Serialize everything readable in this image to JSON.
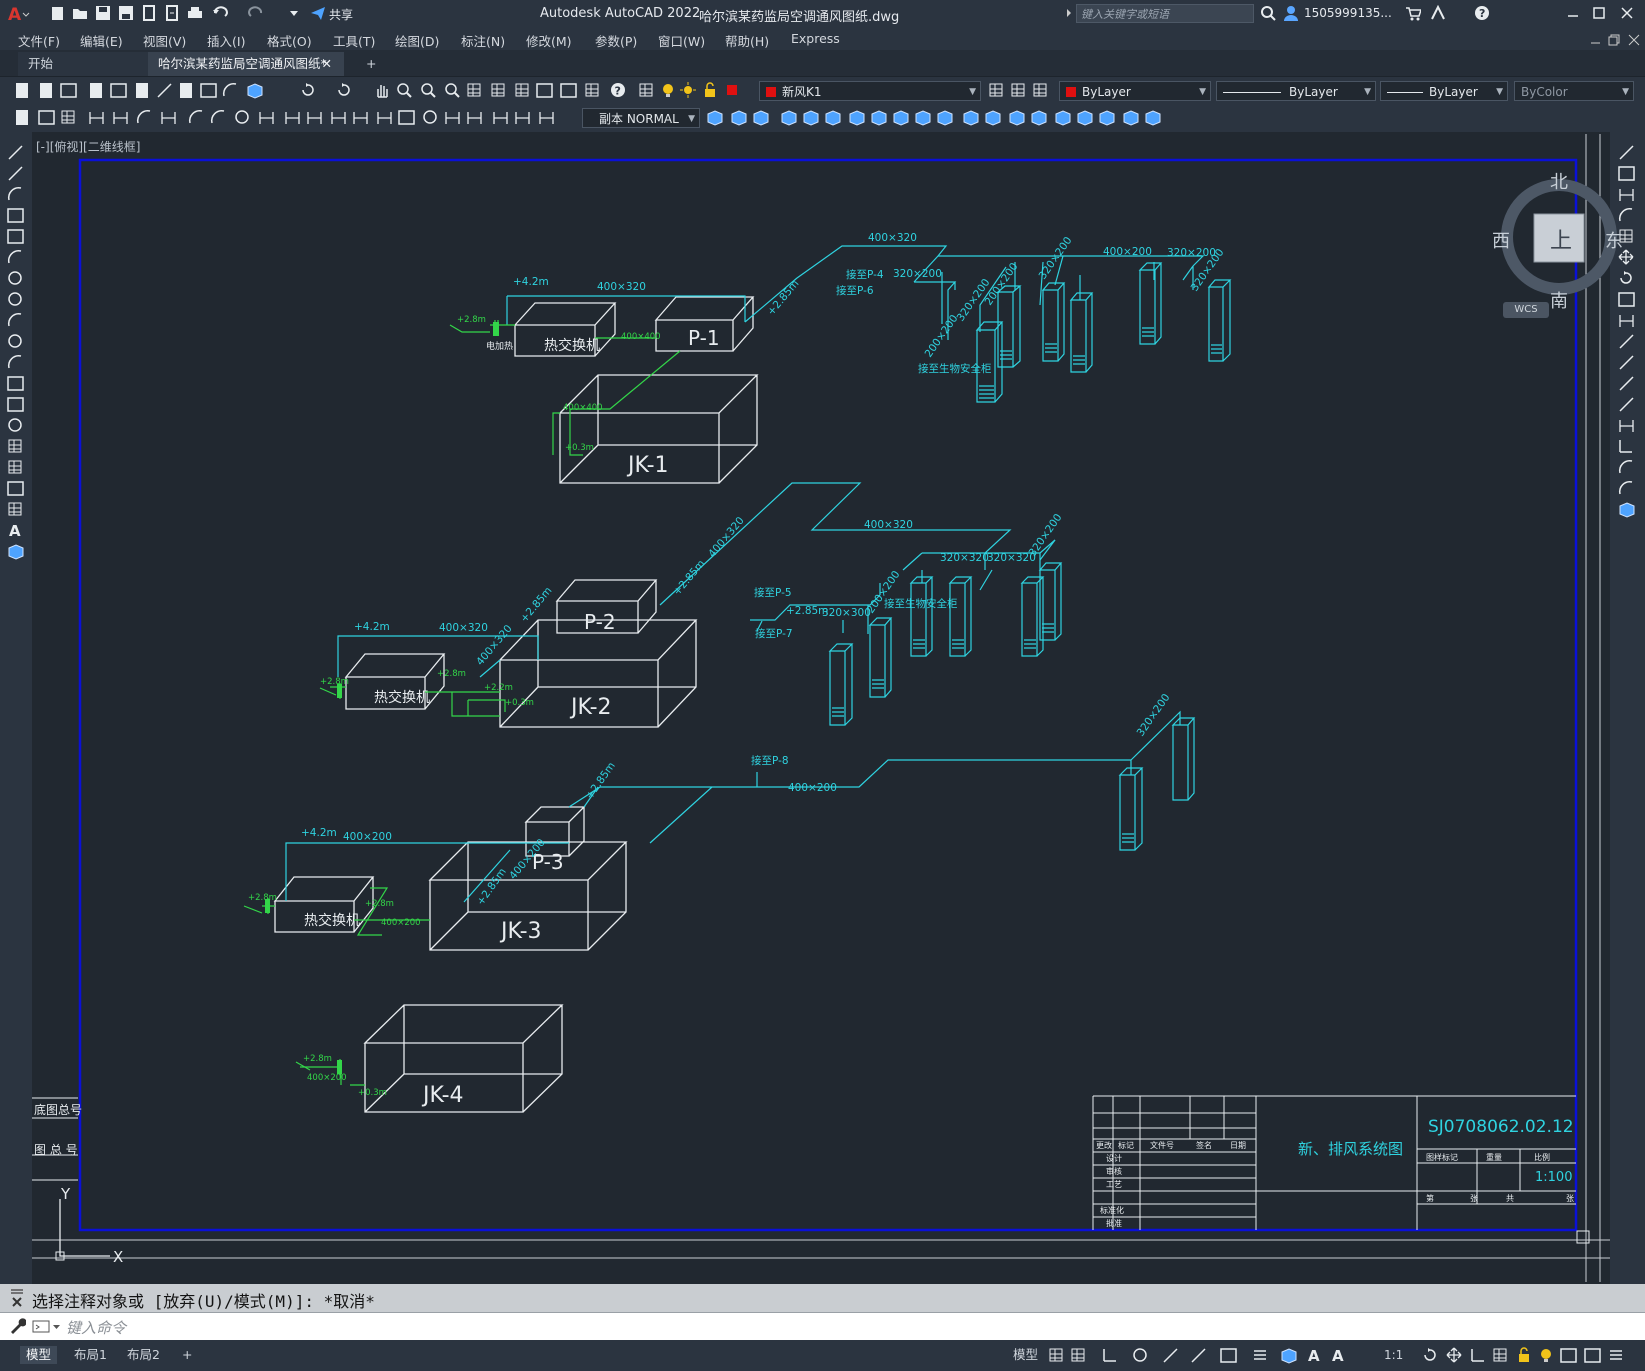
{
  "app": {
    "title": "Autodesk AutoCAD 2022",
    "filename": "哈尔滨某药监局空调通风图纸.dwg",
    "search_placeholder": "键入关键字或短语",
    "user": "1505999135...",
    "share_label": "共享"
  },
  "menu": [
    "文件(F)",
    "编辑(E)",
    "视图(V)",
    "插入(I)",
    "格式(O)",
    "工具(T)",
    "绘图(D)",
    "标注(N)",
    "修改(M)",
    "参数(P)",
    "窗口(W)",
    "帮助(H)",
    "Express"
  ],
  "tabs": {
    "start": "开始",
    "document": "哈尔滨某药监局空调通风图纸*",
    "add": "+"
  },
  "toolbar": {
    "layer": "新风K1",
    "color": "ByLayer",
    "linetype": "ByLayer",
    "lineweight": "ByLayer",
    "plotstyle": "ByColor",
    "dimstyle": "副本 NORMAL"
  },
  "viewport": {
    "label": "[-][俯视][二维线框]"
  },
  "viewcube": {
    "north": "北",
    "south": "南",
    "east": "东",
    "west": "西",
    "top": "上",
    "wcs": "WCS"
  },
  "drawing": {
    "units": {
      "jk1": "JK-1",
      "jk2": "JK-2",
      "jk3": "JK-3",
      "jk4": "JK-4",
      "p1": "P-1",
      "p2": "P-2",
      "p3": "P-3",
      "hx": "热交换机",
      "heater": "电加热"
    },
    "duct_labels": {
      "a1": "400×320",
      "a2": "400×320",
      "a3": "320×200",
      "a4": "400×200",
      "a5": "320×200",
      "a6": "200×200",
      "a7": "320×200",
      "a8": "200×200",
      "a9": "320×200",
      "a10": "320×200",
      "a11": "400×400",
      "a12": "400×400",
      "b1": "400×320",
      "b2": "400×320",
      "b3": "400×320",
      "b4": "400×320",
      "b5": "320×320",
      "b6": "320×320",
      "b7": "320×200",
      "b8": "320×300",
      "b9": "200×200",
      "c1": "400×200",
      "c2": "400×200",
      "c3": "400×200",
      "c4": "400×200",
      "c5": "320×200",
      "d1": "400×200"
    },
    "elevations": {
      "e42": "+4.2m",
      "e28": "+2.8m",
      "e03": "+0.3m",
      "e285": "+2.85m",
      "e22": "+2.2m"
    },
    "notes": {
      "n1": "接至P-4",
      "n2": "接至P-6",
      "n3": "接至P-5",
      "n4": "接至P-7",
      "n5": "接至P-8",
      "n6": "接至生物安全柜",
      "n7": "接至生物安全柜"
    },
    "axis": {
      "y": "Y",
      "x": "X"
    },
    "side_labels": {
      "s1": "底图总号",
      "s2": "图 总 号"
    }
  },
  "title_block": {
    "drawing_name": "新、排风系统图",
    "drawing_no": "SJ0708062.02.12",
    "scale": "1:100",
    "header": {
      "h1": "更改",
      "h2": "标记",
      "h3": "文件号",
      "h4": "签名",
      "h5": "日期"
    },
    "rows": {
      "r1": "设计",
      "r2": "审核",
      "r3": "工艺",
      "r4": "标准化",
      "r5": "批准"
    },
    "info": {
      "i1": "图样标记",
      "i2": "重量",
      "i3": "比例",
      "i4": "第",
      "i5": "张",
      "i6": "共",
      "i7": "张"
    }
  },
  "command": {
    "history": "选择注释对象或 [放弃(U)/模式(M)]: *取消*",
    "placeholder": "键入命令"
  },
  "status": {
    "tabs": [
      "模型",
      "布局1",
      "布局2"
    ],
    "model_btn": "模型",
    "scale": "1:1"
  },
  "colors": {
    "cyan": "#2fd3e0",
    "green": "#33d649",
    "white": "#e8ecef",
    "blue_frame": "#0a10d8",
    "bg": "#212830"
  }
}
